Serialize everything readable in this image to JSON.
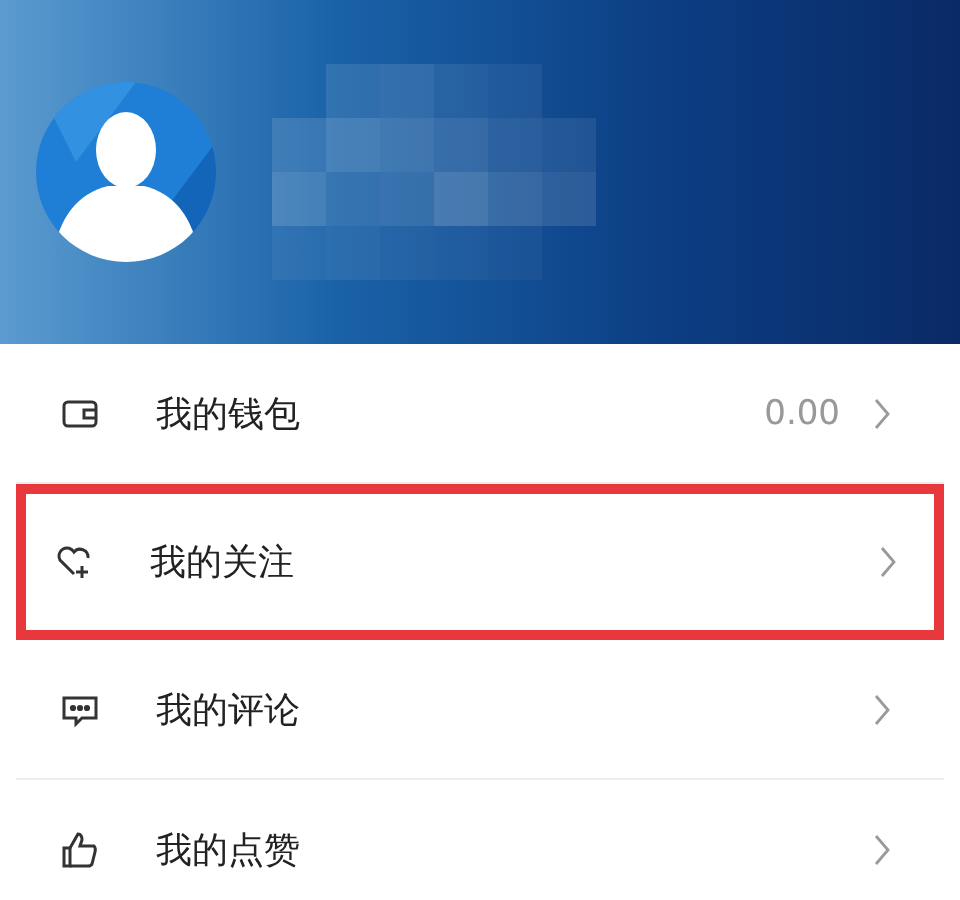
{
  "menu": [
    {
      "kind": "wallet",
      "label": "我的钱包",
      "value": "0.00",
      "highlighted": false
    },
    {
      "kind": "follow",
      "label": "我的关注",
      "highlighted": true
    },
    {
      "kind": "comment",
      "label": "我的评论",
      "highlighted": false
    },
    {
      "kind": "like",
      "label": "我的点赞",
      "highlighted": false
    }
  ]
}
